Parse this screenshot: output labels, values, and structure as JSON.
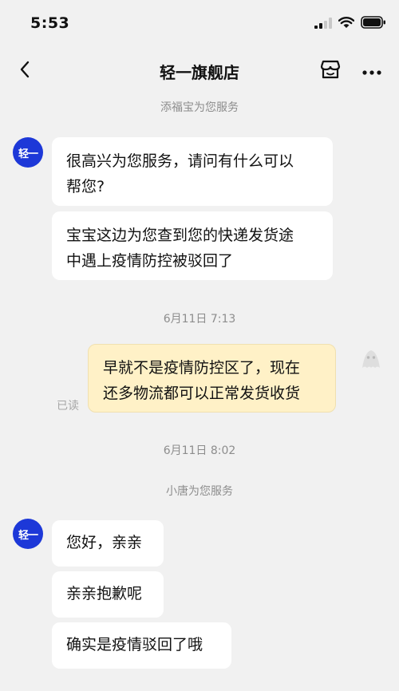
{
  "status_bar": {
    "time": "5:53"
  },
  "nav": {
    "title": "轻一旗舰店"
  },
  "avatars": {
    "store_text": "轻一"
  },
  "chat": {
    "system_note_1": "添福宝为您服务",
    "message_1_lines": [
      "很高兴为您服务，请问有什么可以",
      "帮您?"
    ],
    "message_2_lines": [
      "宝宝这边为您查到您的快递发货途",
      "中遇上疫情防控被驳回了"
    ],
    "timestamp_1": "6月11日 7:13",
    "outgoing_lines": [
      "早就不是疫情防控区了，现在",
      "还多物流都可以正常发货收货"
    ],
    "read_status": "已读",
    "timestamp_2": "6月11日 8:02",
    "system_note_2": "小唐为您服务",
    "message_3": "您好，亲亲",
    "message_4": "亲亲抱歉呢",
    "message_5": "确实是疫情驳回了哦"
  },
  "colors": {
    "background": "#f1f1f1",
    "store_avatar": "#1d38d8",
    "outgoing_bubble": "#fff1c7",
    "incoming_bubble": "#ffffff"
  },
  "icons": {
    "back": "chevron-left-icon",
    "shop": "shop-icon",
    "more": "more-icon",
    "signal": "signal-icon",
    "wifi": "wifi-icon",
    "battery": "battery-icon",
    "user_avatar": "ghost-avatar-icon"
  }
}
